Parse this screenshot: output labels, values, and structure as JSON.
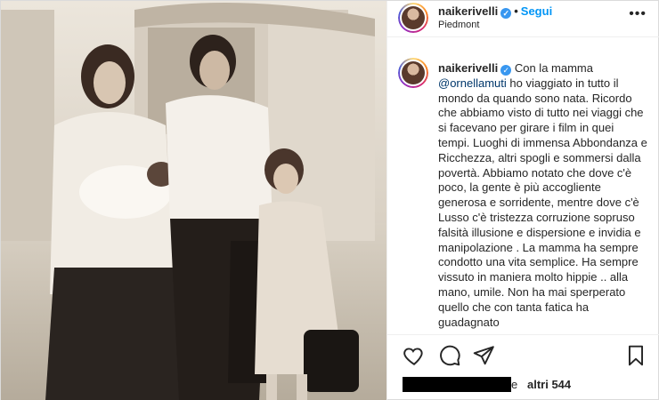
{
  "post": {
    "username": "naikerivelli",
    "follow_label": "Segui",
    "separator": "•",
    "location": "Piedmont",
    "more_label": "•••",
    "verified_mark": "✓"
  },
  "caption": {
    "username": "naikerivelli",
    "intro": "Con la mamma",
    "mention": "@ornellamuti",
    "body": " ho viaggiato in tutto il mondo da quando sono nata. Ricordo che abbiamo visto di tutto nei viaggi che si facevano per girare i film in quei tempi. Luoghi di immensa Abbondanza e Ricchezza, altri spogli e sommersi dalla povertà. Abbiamo notato che dove c'è poco, la gente è più accogliente generosa e sorridente, mentre dove c'è Lusso c'è tristezza corruzione sopruso falsità illusione e dispersione e invidia e manipolazione . La mamma ha sempre condotto una vita semplice. Ha sempre vissuto in maniera molto hippie .. alla mano, umile. Non ha mai sperperato quello che con tanta fatica ha guadagnato"
  },
  "actions": {
    "like_icon": "heart-icon",
    "comment_icon": "comment-icon",
    "share_icon": "paper-plane-icon",
    "save_icon": "bookmark-icon"
  },
  "likes": {
    "tail": "e",
    "label": "altri 544"
  },
  "colors": {
    "accent": "#0095f6",
    "verified": "#3897f0",
    "text": "#262626",
    "border": "#dbdbdb",
    "mention": "#00376b"
  }
}
